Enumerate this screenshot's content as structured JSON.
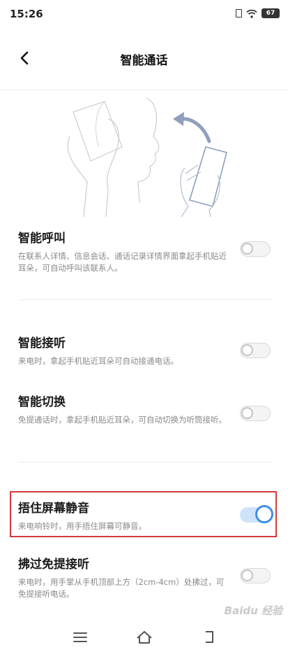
{
  "status_bar": {
    "time": "15:26",
    "battery": "67",
    "icons": [
      "sim-card-icon",
      "wifi-icon",
      "battery-icon"
    ]
  },
  "header": {
    "title": "智能通话",
    "back_icon": "chevron-left-icon"
  },
  "settings": [
    {
      "id": "smart-call",
      "title": "智能呼叫",
      "desc": "在联系人详情、信息会话、通话记录详情界面拿起手机贴近耳朵，可自动呼叫该联系人。",
      "enabled": false
    },
    {
      "id": "smart-answer",
      "title": "智能接听",
      "desc": "来电时，拿起手机贴近耳朵可自动接通电话。",
      "enabled": false
    },
    {
      "id": "smart-switch",
      "title": "智能切换",
      "desc": "免提通话时，拿起手机贴近耳朵，可自动切换为听筒接听。",
      "enabled": false
    },
    {
      "id": "cover-mute",
      "title": "捂住屏幕静音",
      "desc": "来电响铃时，用手捂住屏幕可静音。",
      "enabled": true
    },
    {
      "id": "swipe-answer",
      "title": "拂过免提接听",
      "desc": "来电时，用手掌从手机顶部上方（2cm-4cm）处拂过，可免提接听电话。",
      "enabled": false
    }
  ],
  "bottom_nav": [
    "menu-icon",
    "home-icon",
    "back-icon"
  ],
  "watermark": "Baidu 经验",
  "colors": {
    "accent": "#3f8ee6",
    "highlight": "#d43b3b"
  }
}
